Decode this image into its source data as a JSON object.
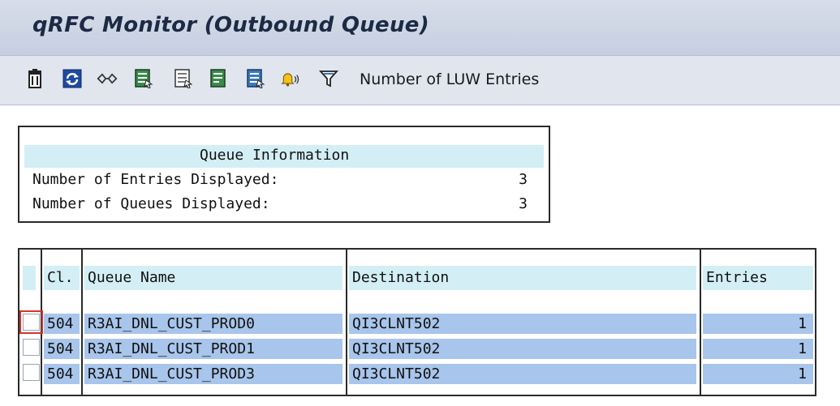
{
  "window": {
    "title": "qRFC Monitor (Outbound Queue)"
  },
  "toolbar": {
    "icons": [
      "trash-icon",
      "refresh-icon",
      "glasses-icon",
      "select-all-icon",
      "deselect-all-icon",
      "select-block-icon",
      "details-icon",
      "alert-bell-icon",
      "filter-icon"
    ],
    "luw_label": "Number of LUW Entries"
  },
  "queue_info": {
    "title": "Queue Information",
    "rows": [
      {
        "label": "Number of Entries Displayed:",
        "value": "3"
      },
      {
        "label": "Number of Queues Displayed:",
        "value": "3"
      }
    ]
  },
  "queue_table": {
    "columns": {
      "client": "Cl.",
      "queue_name": "Queue Name",
      "destination": "Destination",
      "entries": "Entries"
    },
    "rows": [
      {
        "client": "504",
        "queue_name": "R3AI_DNL_CUST_PROD0",
        "destination": "QI3CLNT502",
        "entries": "1",
        "focused": true
      },
      {
        "client": "504",
        "queue_name": "R3AI_DNL_CUST_PROD1",
        "destination": "QI3CLNT502",
        "entries": "1",
        "focused": false
      },
      {
        "client": "504",
        "queue_name": "R3AI_DNL_CUST_PROD3",
        "destination": "QI3CLNT502",
        "entries": "1",
        "focused": false
      }
    ]
  },
  "colors": {
    "title_bar": "#c9d2e3",
    "toolbar": "#e0e5ee",
    "header_cell": "#d3eff5",
    "selected_row": "#a8c5eb",
    "focus_border": "#d8332a"
  }
}
